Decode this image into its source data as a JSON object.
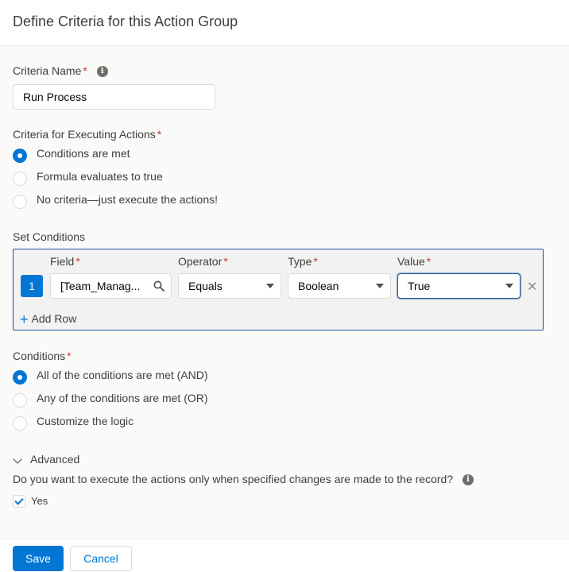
{
  "header": {
    "title": "Define Criteria for this Action Group"
  },
  "criteria_name": {
    "label": "Criteria Name",
    "required_mark": "*",
    "value": "Run Process"
  },
  "executing": {
    "label": "Criteria for Executing Actions",
    "required_mark": "*",
    "options": [
      {
        "label": "Conditions are met",
        "selected": true
      },
      {
        "label": "Formula evaluates to true",
        "selected": false
      },
      {
        "label": "No criteria—just execute the actions!",
        "selected": false
      }
    ]
  },
  "set_conditions": {
    "label": "Set Conditions",
    "columns": {
      "field": "Field",
      "operator": "Operator",
      "type": "Type",
      "value": "Value",
      "required_mark": "*"
    },
    "rows": [
      {
        "number": "1",
        "field": "[Team_Manag...",
        "operator": "Equals",
        "type": "Boolean",
        "value": "True"
      }
    ],
    "add_row_label": "Add Row"
  },
  "conditions": {
    "label": "Conditions",
    "required_mark": "*",
    "options": [
      {
        "label": "All of the conditions are met (AND)",
        "selected": true
      },
      {
        "label": "Any of the conditions are met (OR)",
        "selected": false
      },
      {
        "label": "Customize the logic",
        "selected": false
      }
    ]
  },
  "advanced": {
    "label": "Advanced",
    "question": "Do you want to execute the actions only when specified changes are made to the record?",
    "checkbox_label": "Yes",
    "checked": true
  },
  "footer": {
    "save_label": "Save",
    "cancel_label": "Cancel"
  },
  "colors": {
    "brand": "#0176d3",
    "required": "#c23934",
    "focus_border": "#1b5297"
  }
}
